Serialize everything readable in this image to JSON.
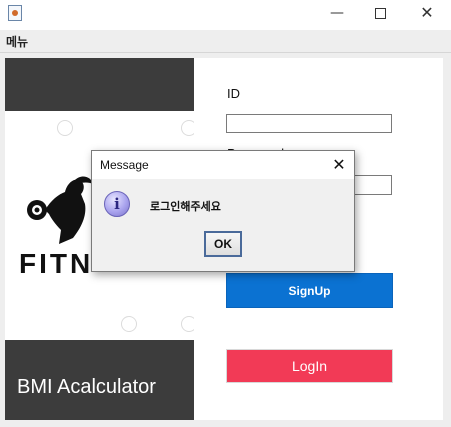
{
  "window": {
    "close_glyph": "✕",
    "minimize_glyph": "—"
  },
  "menubar": {
    "menu_label": "메뉴"
  },
  "left_panel": {
    "brand_label": "BMI Acalculator",
    "logo_text": "FITN",
    "icons": [
      "dumbbell-icon",
      "athlete-silhouette"
    ]
  },
  "form": {
    "id_label": "ID",
    "id_value": "",
    "password_label": "Password",
    "password_value": "",
    "signup_label": "SignUp",
    "login_label": "LogIn"
  },
  "dialog": {
    "title": "Message",
    "message": "로그인해주세요",
    "ok_label": "OK",
    "close_glyph": "✕",
    "info_glyph": "i"
  },
  "colors": {
    "signup_bg": "#0b72d2",
    "login_bg": "#f23a56",
    "dark_panel": "#3c3c3c",
    "info_icon": "#a9a3ee"
  }
}
